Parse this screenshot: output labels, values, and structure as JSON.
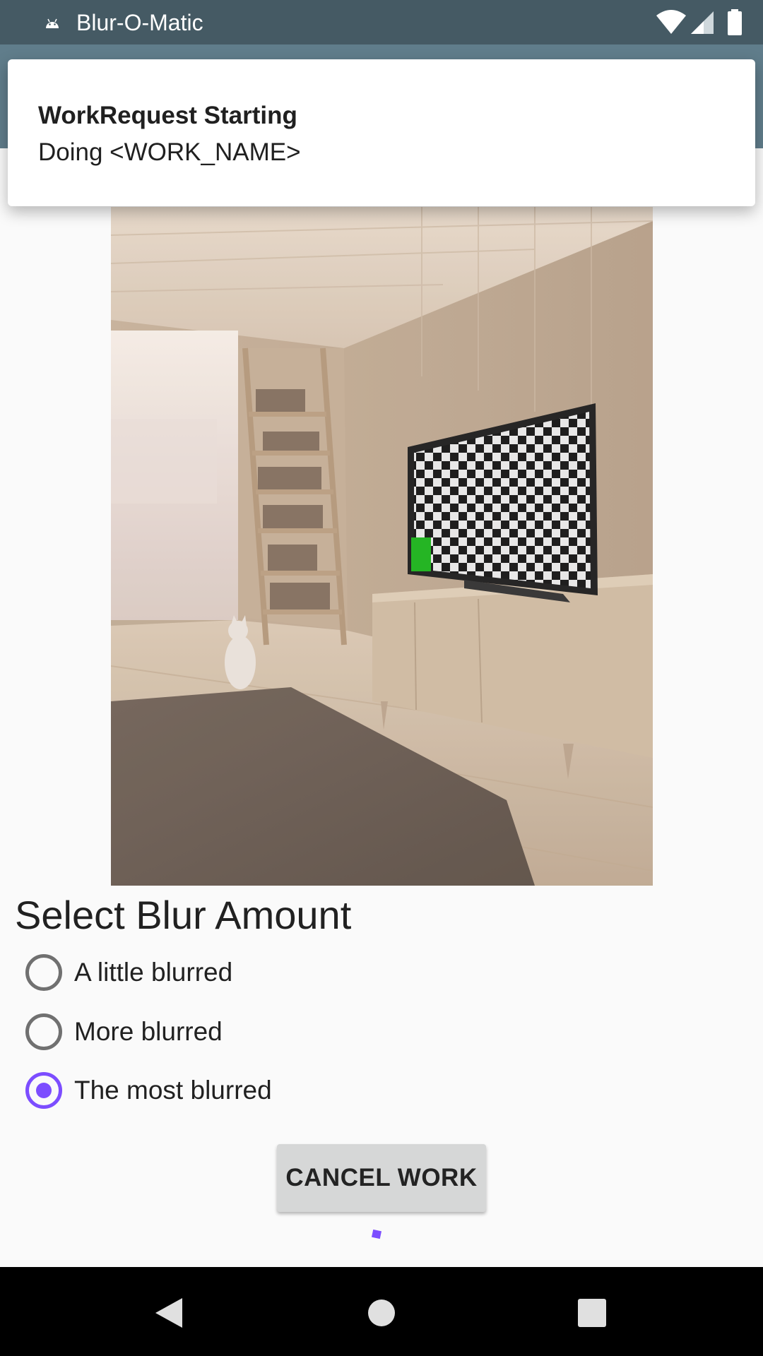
{
  "status_bar": {
    "app_title": "Blur-O-Matic",
    "icons": [
      "android-icon",
      "wifi-icon",
      "signal-icon",
      "battery-icon"
    ]
  },
  "notification": {
    "title": "WorkRequest Starting",
    "text": "Doing <WORK_NAME>"
  },
  "main": {
    "section_title": "Select Blur Amount",
    "blur_options": [
      {
        "label": "A little blurred",
        "checked": false
      },
      {
        "label": "More blurred",
        "checked": false
      },
      {
        "label": "The most blurred",
        "checked": true
      }
    ],
    "cancel_button_label": "CANCEL WORK"
  },
  "navigation": {
    "buttons": [
      "back-icon",
      "home-icon",
      "recents-icon"
    ]
  },
  "colors": {
    "status_bar": "#455a64",
    "app_bar": "#607d8b",
    "accent": "#7c4dff",
    "button": "#d6d7d7"
  }
}
